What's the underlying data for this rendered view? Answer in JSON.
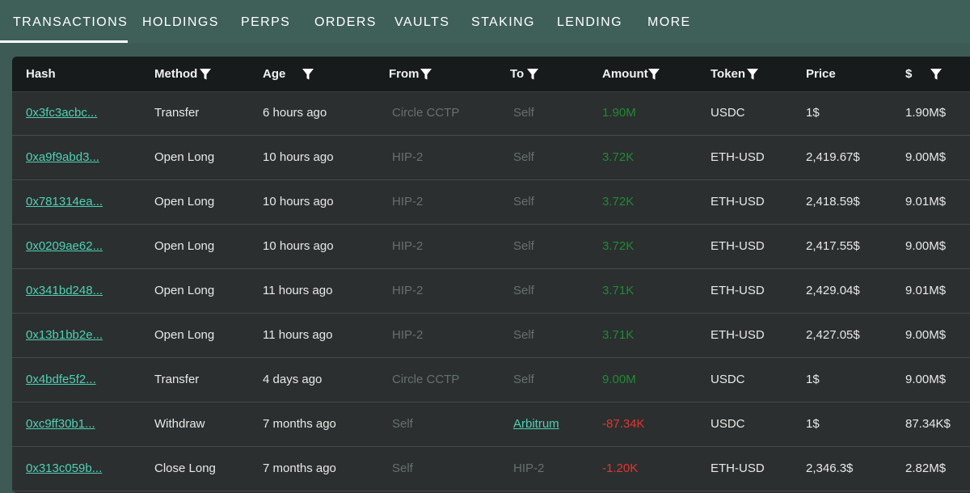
{
  "tabs": [
    {
      "label": "TRANSACTIONS",
      "active": true
    },
    {
      "label": "HOLDINGS"
    },
    {
      "label": "PERPS"
    },
    {
      "label": "ORDERS"
    },
    {
      "label": "VAULTS"
    },
    {
      "label": "STAKING"
    },
    {
      "label": "LENDING"
    },
    {
      "label": "MORE"
    }
  ],
  "table": {
    "columns": [
      "Hash",
      "Method",
      "Age",
      "From",
      "To",
      "Amount",
      "Token",
      "Price",
      "$"
    ],
    "rows": [
      {
        "hash": "0x3fc3acbc...",
        "method": "Transfer",
        "age": "6 hours ago",
        "from": "Circle CCTP",
        "to": "Self",
        "amount": "1.90M",
        "amount_sign": "pos",
        "token": "USDC",
        "price": "1$",
        "usd": "1.90M$"
      },
      {
        "hash": "0xa9f9abd3...",
        "method": "Open Long",
        "age": "10 hours ago",
        "from": "HIP-2",
        "to": "Self",
        "amount": "3.72K",
        "amount_sign": "pos",
        "token": "ETH-USD",
        "price": "2,419.67$",
        "usd": "9.00M$"
      },
      {
        "hash": "0x781314ea...",
        "method": "Open Long",
        "age": "10 hours ago",
        "from": "HIP-2",
        "to": "Self",
        "amount": "3.72K",
        "amount_sign": "pos",
        "token": "ETH-USD",
        "price": "2,418.59$",
        "usd": "9.01M$"
      },
      {
        "hash": "0x0209ae62...",
        "method": "Open Long",
        "age": "10 hours ago",
        "from": "HIP-2",
        "to": "Self",
        "amount": "3.72K",
        "amount_sign": "pos",
        "token": "ETH-USD",
        "price": "2,417.55$",
        "usd": "9.00M$"
      },
      {
        "hash": "0x341bd248...",
        "method": "Open Long",
        "age": "11 hours ago",
        "from": "HIP-2",
        "to": "Self",
        "amount": "3.71K",
        "amount_sign": "pos",
        "token": "ETH-USD",
        "price": "2,429.04$",
        "usd": "9.01M$"
      },
      {
        "hash": "0x13b1bb2e...",
        "method": "Open Long",
        "age": "11 hours ago",
        "from": "HIP-2",
        "to": "Self",
        "amount": "3.71K",
        "amount_sign": "pos",
        "token": "ETH-USD",
        "price": "2,427.05$",
        "usd": "9.00M$"
      },
      {
        "hash": "0x4bdfe5f2...",
        "method": "Transfer",
        "age": "4 days ago",
        "from": "Circle CCTP",
        "to": "Self",
        "amount": "9.00M",
        "amount_sign": "pos",
        "token": "USDC",
        "price": "1$",
        "usd": "9.00M$"
      },
      {
        "hash": "0xc9ff30b1...",
        "method": "Withdraw",
        "age": "7 months ago",
        "from": "Self",
        "to": "Arbitrum",
        "to_link": true,
        "amount": "-87.34K",
        "amount_sign": "neg",
        "token": "USDC",
        "price": "1$",
        "usd": "87.34K$"
      },
      {
        "hash": "0x313c059b...",
        "method": "Close Long",
        "age": "7 months ago",
        "from": "Self",
        "to": "HIP-2",
        "amount": "-1.20K",
        "amount_sign": "neg",
        "token": "ETH-USD",
        "price": "2,346.3$",
        "usd": "2.82M$"
      }
    ]
  },
  "icons": {
    "filter": "filter-funnel-icon"
  },
  "colors": {
    "tab_bar": "#3f5f59",
    "table_bg": "#2b2f2f",
    "header_bg": "#181b1b",
    "hash_link": "#4fd1b5",
    "positive": "#1f8a34",
    "negative": "#e33535",
    "muted": "#66706f"
  }
}
